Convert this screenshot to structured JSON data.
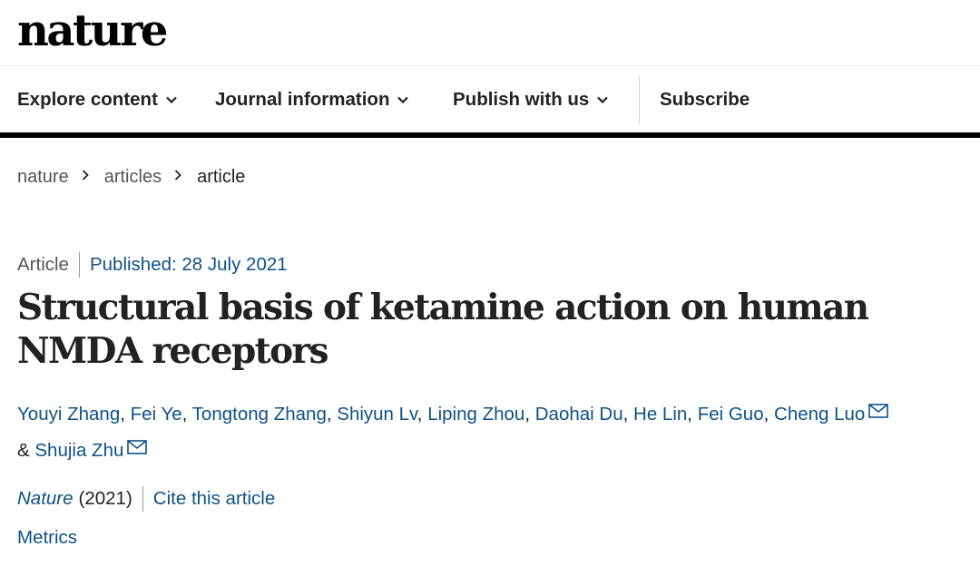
{
  "site": {
    "logo": "nature"
  },
  "nav": {
    "items": [
      {
        "label": "Explore content",
        "icon": "chevron-down-icon"
      },
      {
        "label": "Journal information",
        "icon": "chevron-down-icon"
      },
      {
        "label": "Publish with us",
        "icon": "chevron-down-icon"
      }
    ],
    "subscribe": "Subscribe"
  },
  "breadcrumb": [
    "nature",
    "articles",
    "article"
  ],
  "article": {
    "type": "Article",
    "published": "Published: 28 July 2021",
    "title": "Structural basis of ketamine action on human NMDA receptors",
    "authors": [
      {
        "name": "Youyi Zhang",
        "sep": ", "
      },
      {
        "name": "Fei Ye",
        "sep": ", "
      },
      {
        "name": "Tongtong Zhang",
        "sep": ", "
      },
      {
        "name": "Shiyun Lv",
        "sep": ", "
      },
      {
        "name": "Liping Zhou",
        "sep": ", "
      },
      {
        "name": "Daohai Du",
        "sep": ", "
      },
      {
        "name": "He Lin",
        "sep": ", "
      },
      {
        "name": "Fei Guo",
        "sep": ", "
      },
      {
        "name": "Cheng Luo",
        "sep": ""
      },
      {
        "name": "Shujia Zhu",
        "sep": ""
      }
    ],
    "ampersand": "& ",
    "journal": "Nature",
    "year": "(2021)",
    "cite": "Cite this article",
    "metrics": "Metrics"
  },
  "colors": {
    "link": "#0f5186",
    "text": "#222222",
    "muted": "#555555",
    "rule": "#000000"
  }
}
